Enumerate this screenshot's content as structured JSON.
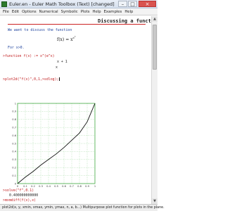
{
  "window": {
    "title": "Euler.en - Euler Math Toolbox (Text) [changed]",
    "minimize": "–",
    "maximize": "□",
    "close": "×"
  },
  "menu": [
    "File",
    "Edit",
    "Options",
    "Numerical",
    "Symbolic",
    "Plots",
    "Help",
    "Examples",
    "Help"
  ],
  "document": {
    "heading": "Discussing a function",
    "intro_comment": "We want to discuss the function",
    "function_display": "f(x) = x^(e^x)",
    "domain_comment": "For x>0.",
    "def_command": ">function f(x) := x^(e^x)",
    "def_output_top": "x + 1",
    "def_output_bottom": "x",
    "plot_command": ">plot2d(\"f(x)\",0,1,>sdlog);",
    "solve_command": ">solve(\"f\",0.1)",
    "solve_result": "0.400000000000",
    "diff_command": ">mxmdiff(f(x),x)",
    "diff_output_top": "x + 1        x + 1",
    "diff_output_mid": "(log(x) + -----)",
    "diff_output_bot": "x"
  },
  "chart_data": {
    "type": "line",
    "x": [
      0,
      0.1,
      0.2,
      0.3,
      0.4,
      0.5,
      0.6,
      0.7,
      0.8,
      0.9,
      1
    ],
    "y": [
      0,
      0.08,
      0.15,
      0.23,
      0.3,
      0.37,
      0.45,
      0.54,
      0.63,
      0.77,
      1
    ],
    "xlim": [
      0,
      1
    ],
    "ylim": [
      0,
      1
    ],
    "xticks": [
      "0",
      "0.1",
      "0.2",
      "0.3",
      "0.4",
      "0.5",
      "0.6",
      "0.7",
      "0.8",
      "0.9",
      "1"
    ],
    "yticks": [
      "0",
      "0.1",
      "0.2",
      "0.3",
      "0.4",
      "0.5",
      "0.6",
      "0.7",
      "0.8",
      "0.9",
      "1"
    ],
    "grid": true,
    "frame_color": "#44aa44",
    "line_color": "#111111"
  },
  "statusbar": {
    "text": "plot2d(x, y, xmin, xmax, ymin, ymax, n, a, b...) Multipurpose plot function for plots in the plane."
  }
}
